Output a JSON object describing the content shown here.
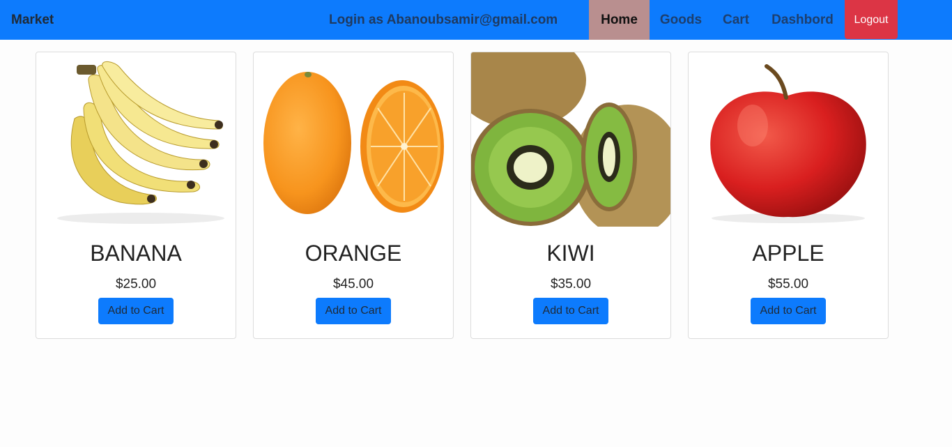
{
  "navbar": {
    "brand": "Market",
    "login_text": "Login as Abanoubsamir@gmail.com",
    "links": {
      "home": "Home",
      "goods": "Goods",
      "cart": "Cart",
      "dashboard": "Dashbord"
    },
    "logout_label": "Logout",
    "active_link": "Home"
  },
  "colors": {
    "navbar_bg": "#0d7bfd",
    "active_link_bg": "#b98f8f",
    "logout_bg": "#dc3545",
    "button_bg": "#0d7bfd"
  },
  "products": [
    {
      "name": "BANANA",
      "price": "$25.00",
      "button": "Add to Cart",
      "image": "banana-image"
    },
    {
      "name": "ORANGE",
      "price": "$45.00",
      "button": "Add to Cart",
      "image": "orange-image"
    },
    {
      "name": "KIWI",
      "price": "$35.00",
      "button": "Add to Cart",
      "image": "kiwi-image"
    },
    {
      "name": "APPLE",
      "price": "$55.00",
      "button": "Add to Cart",
      "image": "apple-image"
    }
  ]
}
